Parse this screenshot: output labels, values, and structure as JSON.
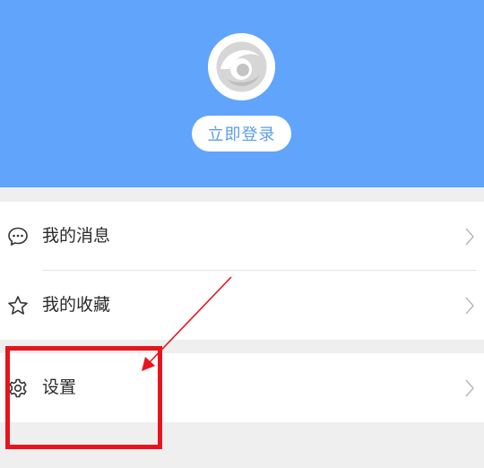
{
  "header": {
    "avatar_icon": "app-logo-avatar-icon",
    "login_label": "立即登录",
    "bg_color": "#60a4fc"
  },
  "menu": {
    "items": [
      {
        "label": "我的消息",
        "icon": "chat-bubble-icon"
      },
      {
        "label": "我的收藏",
        "icon": "star-icon"
      },
      {
        "label": "设置",
        "icon": "gear-icon"
      }
    ]
  },
  "annotation": {
    "box_color": "#e8141c",
    "arrow_color": "#e8141c"
  }
}
